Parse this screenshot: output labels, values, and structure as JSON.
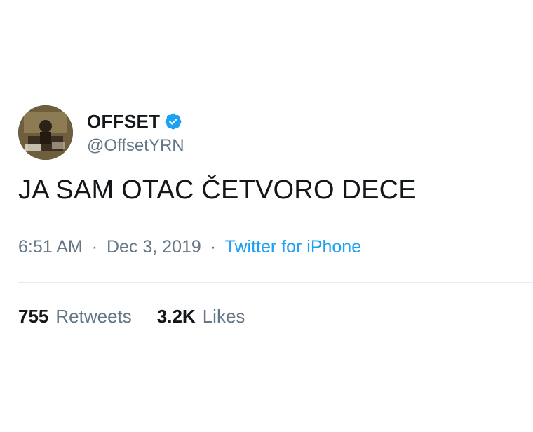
{
  "author": {
    "display_name": "OFFSET",
    "handle": "@OffsetYRN",
    "verified": true
  },
  "icons": {
    "verified": "verified-badge-icon",
    "avatar": "profile-photo"
  },
  "tweet": {
    "text": "JA SAM OTAC ČETVORO DECE",
    "time": "6:51 AM",
    "date": "Dec 3, 2019",
    "source": "Twitter for iPhone",
    "separator": "·"
  },
  "stats": {
    "retweets_count": "755",
    "retweets_label": "Retweets",
    "likes_count": "3.2K",
    "likes_label": "Likes"
  },
  "colors": {
    "primary_text": "#14171a",
    "secondary_text": "#657786",
    "link": "#1da1f2",
    "divider": "#e6ecf0",
    "verified_badge": "#1da1f2"
  }
}
